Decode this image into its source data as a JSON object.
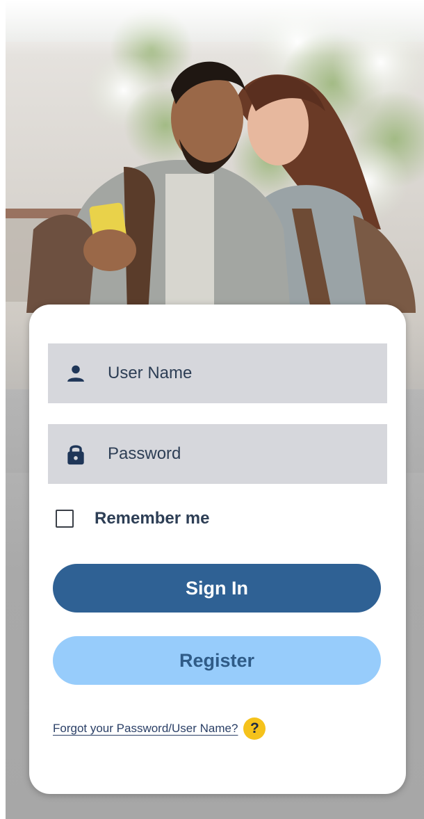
{
  "hero": {
    "image": "couple-looking-at-phone-photo"
  },
  "login": {
    "username": {
      "placeholder": "User Name",
      "icon": "person-icon"
    },
    "password": {
      "placeholder": "Password",
      "icon": "lock-icon"
    },
    "remember": {
      "label": "Remember me",
      "checked": false
    },
    "sign_in_label": "Sign In",
    "register_label": "Register",
    "forgot_label": "Forgot your Password/User Name?",
    "help_glyph": "?"
  },
  "colors": {
    "primary": "#2f6194",
    "secondary": "#97ccfb",
    "field_bg": "#d6d7dc",
    "text": "#2d3e55",
    "help": "#f5c21b"
  }
}
